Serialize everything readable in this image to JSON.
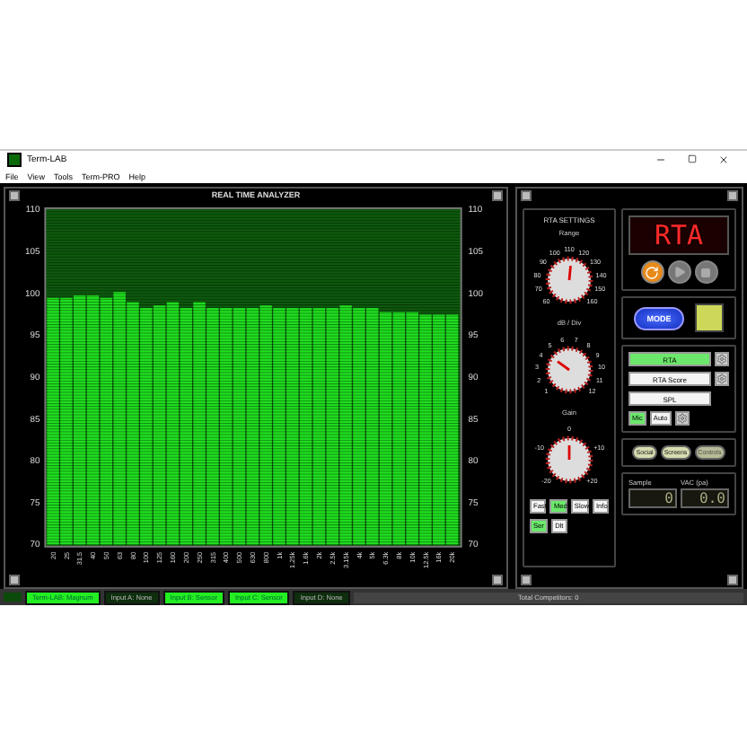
{
  "window": {
    "title": "Term-LAB"
  },
  "menu": [
    "File",
    "View",
    "Tools",
    "Term-PRO",
    "Help"
  ],
  "analyzer": {
    "title": "REAL TIME ANALYZER",
    "chart_data": {
      "type": "bar",
      "categories": [
        "20",
        "25",
        "31.5",
        "40",
        "50",
        "63",
        "80",
        "100",
        "125",
        "160",
        "200",
        "250",
        "315",
        "400",
        "500",
        "630",
        "800",
        "1k",
        "1.25k",
        "1.6k",
        "2k",
        "2.5k",
        "3.15k",
        "4k",
        "5k",
        "6.3k",
        "8k",
        "10k",
        "12.5k",
        "16k",
        "20k"
      ],
      "series": [
        {
          "color": "#22e022",
          "values": [
            99.5,
            99.5,
            99.8,
            99.8,
            99.5,
            100.2,
            99,
            98.3,
            98.6,
            99,
            98.3,
            99,
            98.3,
            98.3,
            98.3,
            98.3,
            98.6,
            98.3,
            98.3,
            98.3,
            98.3,
            98.3,
            98.6,
            98.3,
            98.3,
            97.8,
            97.8,
            97.8,
            97.5,
            97.5,
            97.5
          ]
        }
      ],
      "ylim": [
        70,
        110
      ],
      "yticks": [
        70,
        75,
        80,
        85,
        90,
        95,
        100,
        105,
        110
      ]
    },
    "right_axis_labels": [
      "110",
      "105",
      "100",
      "95",
      "90",
      "85",
      "80",
      "75",
      "70"
    ]
  },
  "settings": {
    "title": "RTA SETTINGS",
    "knobs": [
      {
        "label": "Range",
        "scale": [
          "60",
          "70",
          "80",
          "90",
          "100",
          "110",
          "120",
          "130",
          "140",
          "150",
          "160"
        ],
        "level": 0.52
      },
      {
        "label": "dB / Div",
        "scale": [
          "1",
          "2",
          "3",
          "4",
          "5",
          "6",
          "7",
          "8",
          "9",
          "10",
          "11",
          "12"
        ],
        "level": 0.3
      },
      {
        "label": "Gain",
        "scale": [
          "-20",
          "-10",
          "0",
          "+10",
          "+20"
        ],
        "level": 0.5
      }
    ],
    "speed_buttons": [
      {
        "label": "Fast",
        "selected": false
      },
      {
        "label": "Med",
        "selected": true
      },
      {
        "label": "Slow",
        "selected": false
      },
      {
        "label": "Info",
        "selected": false
      }
    ],
    "mode_buttons": [
      {
        "label": "Ser",
        "selected": true
      },
      {
        "label": "Dlt",
        "selected": false
      }
    ]
  },
  "display": {
    "text": "RTA"
  },
  "mode_button": "MODE",
  "modes": [
    {
      "label": "RTA",
      "selected": true
    },
    {
      "label": "RTA Score",
      "selected": false
    },
    {
      "label": "SPL",
      "selected": false
    }
  ],
  "input_buttons": [
    {
      "label": "Mic",
      "selected": true
    },
    {
      "label": "Auto",
      "selected": false
    }
  ],
  "nav_buttons": [
    {
      "label": "Social",
      "disabled": false
    },
    {
      "label": "Screens",
      "disabled": false
    },
    {
      "label": "Controls",
      "disabled": true
    }
  ],
  "readouts": [
    {
      "label": "Sample",
      "value": "0"
    },
    {
      "label": "VAC (pa)",
      "value": "0.0"
    }
  ],
  "status": {
    "segments": [
      {
        "label": "Term-LAB: Magnum",
        "active": true
      },
      {
        "label": "Input A: None",
        "active": false
      },
      {
        "label": "Input B: Sensor",
        "active": true
      },
      {
        "label": "Input C: Sensor",
        "active": true
      },
      {
        "label": "Input D: None",
        "active": false
      }
    ],
    "total": "Total Competitors: 0"
  }
}
